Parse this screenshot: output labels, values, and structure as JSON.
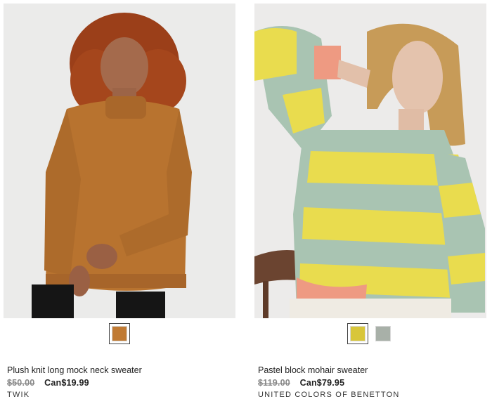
{
  "products": [
    {
      "name": "Plush knit long mock neck sweater",
      "original_price": "$50.00",
      "sale_price": "Can$19.99",
      "brand": "TWIK",
      "swatches": [
        {
          "color": "#c07a33",
          "selected": true
        }
      ]
    },
    {
      "name": "Pastel block mohair sweater",
      "original_price": "$119.00",
      "sale_price": "Can$79.95",
      "brand": "UNITED COLORS OF BENETTON",
      "swatches": [
        {
          "color": "#d8c63a",
          "selected": true
        },
        {
          "color": "#a8b0a8",
          "selected": false
        }
      ]
    }
  ],
  "colors": {
    "mustard_sweater": "#b8732f",
    "stripe_yellow": "#e9dc4e",
    "stripe_mint": "#a9c4b2",
    "cuff_coral": "#ee9a82",
    "photo_bg": "#ecebea"
  }
}
